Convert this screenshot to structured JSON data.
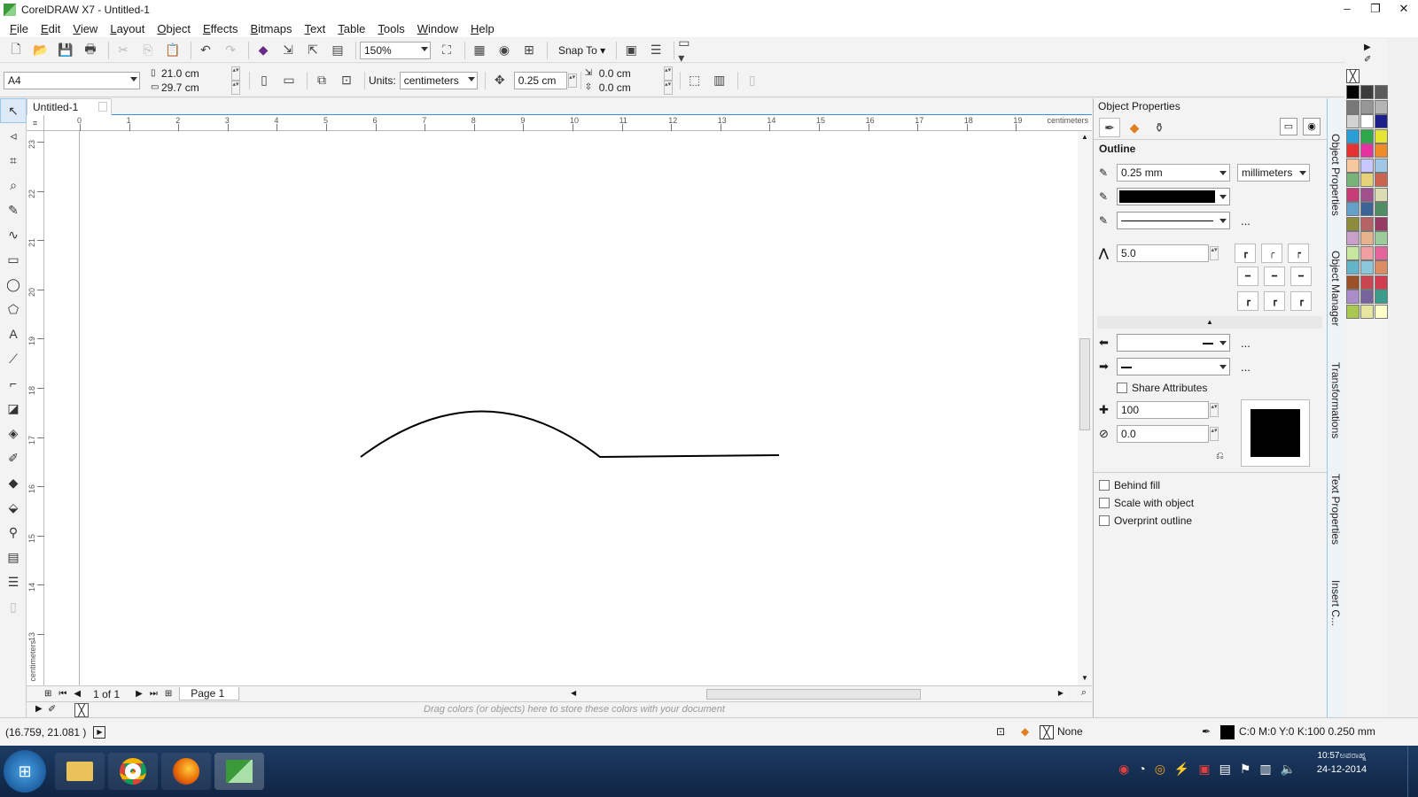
{
  "window": {
    "title": "CorelDRAW X7 - Untitled-1",
    "minimize": "–",
    "maximize": "❐",
    "close": "✕"
  },
  "menu": [
    "File",
    "Edit",
    "View",
    "Layout",
    "Object",
    "Effects",
    "Bitmaps",
    "Text",
    "Table",
    "Tools",
    "Window",
    "Help"
  ],
  "toolbar": {
    "zoom": "150%",
    "snap_to": "Snap To"
  },
  "propbar": {
    "page_size": "A4",
    "width": "21.0 cm",
    "height": "29.7 cm",
    "units_label": "Units:",
    "units_value": "centimeters",
    "nudge": "0.25 cm",
    "dup_x": "0.0 cm",
    "dup_y": "0.0 cm"
  },
  "document": {
    "tab": "Untitled-1",
    "ruler_unit": "centimeters"
  },
  "ruler": {
    "h_ticks": [
      "0",
      "1",
      "2",
      "3",
      "4",
      "5",
      "6",
      "7",
      "8",
      "9",
      "10",
      "11",
      "12",
      "13",
      "14",
      "15",
      "16",
      "17",
      "18",
      "19"
    ],
    "v_ticks": [
      "23",
      "22",
      "21",
      "20",
      "19",
      "18",
      "17",
      "16",
      "15",
      "14",
      "13"
    ],
    "v_unit": "centimeters"
  },
  "pagenav": {
    "counter": "1 of 1",
    "page_tab": "Page 1"
  },
  "colorwell": {
    "hint": "Drag colors (or objects) here to store these colors with your document"
  },
  "status": {
    "coords": "(16.759, 21.081 )",
    "fill": "None",
    "outline": "C:0 M:0 Y:0 K:100  0.250 mm"
  },
  "docker": {
    "title": "Object Properties",
    "section": "Outline",
    "width": "0.25 mm",
    "units": "millimeters",
    "miter": "5.0",
    "share_attributes": "Share Attributes",
    "stretch": "100",
    "angle": "0.0",
    "behind_fill": "Behind fill",
    "scale_with_object": "Scale with object",
    "overprint_outline": "Overprint outline",
    "more": "..."
  },
  "docker_tabs": [
    "Object Properties",
    "Object Manager",
    "Transformations",
    "Text Properties",
    "Insert C..."
  ],
  "palette_colors": [
    "#000000",
    "#3c3c3c",
    "#5a5a5a",
    "#787878",
    "#969696",
    "#b4b4b4",
    "#d2d2d2",
    "#ffffff",
    "#1f1f8c",
    "#2a9fd6",
    "#2ca84a",
    "#e6e632",
    "#e63232",
    "#e632a0",
    "#f08c28",
    "#f5c8a0",
    "#c8c8ff",
    "#a0c8e6",
    "#78b478",
    "#e6d278",
    "#c86450",
    "#c83c78",
    "#a0508c",
    "#dcdcb4",
    "#64a0c8",
    "#3c6496",
    "#508c64",
    "#8c8c3c",
    "#b46464",
    "#963c64",
    "#c8a0c8",
    "#e6b48c",
    "#9ccb9c",
    "#c8e6a0",
    "#f0a0a0",
    "#e6649c",
    "#64b4c8",
    "#8cc8dc",
    "#dc8c64",
    "#9c5028",
    "#c84650",
    "#d23c50",
    "#aa8cc8",
    "#78649c",
    "#3c9c8c",
    "#aac850",
    "#e6e6a0",
    "#ffffc8"
  ],
  "clock": {
    "time": "10:57ಅಪರಾಹ್ನ",
    "date": "24-12-2014"
  }
}
